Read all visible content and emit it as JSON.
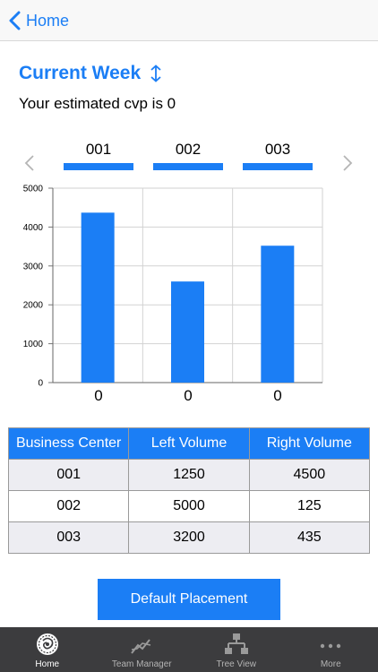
{
  "nav": {
    "back_label": "Home"
  },
  "week": {
    "title": "Current Week",
    "toggle_icon": "up-down-arrows-icon"
  },
  "cvp_text": "Your estimated cvp is 0",
  "colors": {
    "accent": "#1b7ef5",
    "tabbar": "#3c3c3e"
  },
  "chart_data": {
    "type": "bar",
    "categories": [
      "001",
      "002",
      "003"
    ],
    "values": [
      4370,
      2600,
      3520
    ],
    "y_ticks": [
      "0",
      "1000",
      "2000",
      "3000",
      "4000",
      "5000"
    ],
    "ylim": [
      0,
      5000
    ],
    "bottom_values": [
      "0",
      "0",
      "0"
    ],
    "grid": true
  },
  "table": {
    "headers": [
      "Business Center",
      "Left Volume",
      "Right Volume"
    ],
    "rows": [
      [
        "001",
        "1250",
        "4500"
      ],
      [
        "002",
        "5000",
        "125"
      ],
      [
        "003",
        "3200",
        "435"
      ]
    ]
  },
  "button_label": "Default Placement",
  "tabs": [
    {
      "label": "Home",
      "icon": "home-logo-icon",
      "active": true
    },
    {
      "label": "Team Manager",
      "icon": "trend-line-icon",
      "active": false
    },
    {
      "label": "Tree View",
      "icon": "tree-hierarchy-icon",
      "active": false
    },
    {
      "label": "More",
      "icon": "more-dots-icon",
      "active": false
    }
  ]
}
